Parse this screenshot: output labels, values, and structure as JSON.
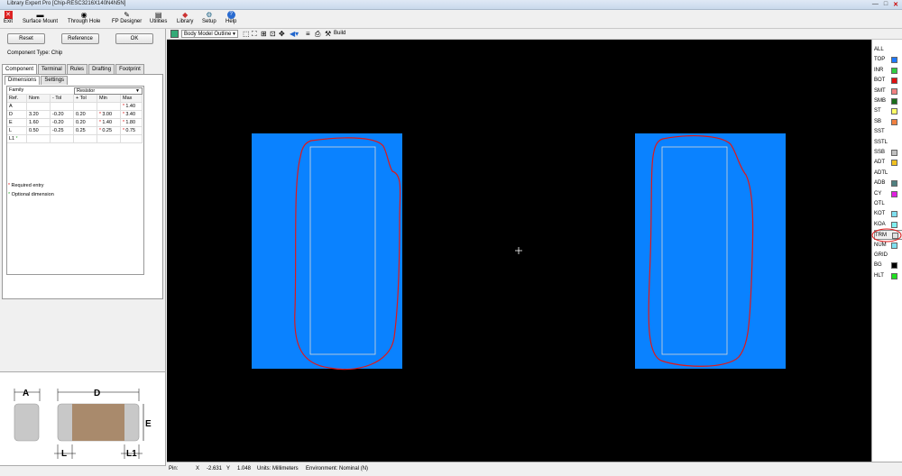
{
  "window": {
    "title": "Library Expert Pro [Chip-RESC3216X140N4N5N]",
    "controls": [
      "—",
      "□",
      "✕"
    ]
  },
  "toolbar": {
    "items": [
      {
        "label": "Exit",
        "icon": "exit-icon"
      },
      {
        "label": "Surface Mount",
        "icon": "surface-mount-icon"
      },
      {
        "label": "Through Hole",
        "icon": "through-hole-icon"
      },
      {
        "label": "FP Designer",
        "icon": "fp-designer-icon"
      },
      {
        "label": "Utilities",
        "icon": "utilities-icon"
      },
      {
        "label": "Library",
        "icon": "library-icon"
      },
      {
        "label": "Setup",
        "icon": "setup-icon"
      },
      {
        "label": "Help",
        "icon": "help-icon"
      }
    ]
  },
  "left": {
    "buttons": {
      "reset": "Reset",
      "reference": "Reference",
      "ok": "OK"
    },
    "component_type": "Component Type: Chip",
    "tabs": [
      "Component",
      "Terminal",
      "Rules",
      "Drafting",
      "Footprint"
    ],
    "subtabs": [
      "Dimensions",
      "Settings"
    ],
    "family_label": "Family",
    "family_value": "Resistor",
    "headers": [
      "Ref.",
      "Nom",
      "- Tol",
      "+ Tol",
      "Min",
      "Max"
    ],
    "rows": [
      {
        "ref": "A",
        "nom": "",
        "mtol": "",
        "ptol": "",
        "min": "",
        "max": "1.40"
      },
      {
        "ref": "D",
        "nom": "3.20",
        "mtol": "-0.20",
        "ptol": "0.20",
        "min": "3.00",
        "max": "3.40"
      },
      {
        "ref": "E",
        "nom": "1.60",
        "mtol": "-0.20",
        "ptol": "0.20",
        "min": "1.40",
        "max": "1.80"
      },
      {
        "ref": "L",
        "nom": "0.50",
        "mtol": "-0.25",
        "ptol": "0.25",
        "min": "0.25",
        "max": "0.75"
      },
      {
        "ref": "L1",
        "nom": "",
        "mtol": "",
        "ptol": "",
        "min": "",
        "max": ""
      }
    ],
    "legend_required": "Required entry",
    "legend_optional": "Optional dimension",
    "diagram_labels": {
      "a": "A",
      "d": "D",
      "e": "E",
      "l": "L",
      "l1": "L1"
    }
  },
  "canvas_toolbar": {
    "view_select": "Body Model Outline",
    "build": "Build"
  },
  "layers": [
    {
      "name": "ALL",
      "color": ""
    },
    {
      "name": "TOP",
      "color": "#1e78ff"
    },
    {
      "name": "INR",
      "color": "#2ecc40"
    },
    {
      "name": "BOT",
      "color": "#e01010"
    },
    {
      "name": "SMT",
      "color": "#f08080"
    },
    {
      "name": "SMB",
      "color": "#1a6e1a"
    },
    {
      "name": "ST",
      "color": "#ffff66"
    },
    {
      "name": "SB",
      "color": "#f08040"
    },
    {
      "name": "SST",
      "color": ""
    },
    {
      "name": "SSTL",
      "color": ""
    },
    {
      "name": "SSB",
      "color": "#c0c0c0"
    },
    {
      "name": "ADT",
      "color": "#f0c020"
    },
    {
      "name": "ADTL",
      "color": ""
    },
    {
      "name": "ADB",
      "color": "#508080"
    },
    {
      "name": "CY",
      "color": "#e020e0"
    },
    {
      "name": "OTL",
      "color": ""
    },
    {
      "name": "KOT",
      "color": "#80e0f0"
    },
    {
      "name": "KOA",
      "color": "#80f0f0"
    },
    {
      "name": "TRM",
      "color": "#e0e0e0"
    },
    {
      "name": "NUM",
      "color": "#80e0f0"
    },
    {
      "name": "GRID",
      "color": ""
    },
    {
      "name": "BG",
      "color": "#000000"
    },
    {
      "name": "HLT",
      "color": "#20e020"
    }
  ],
  "status": {
    "pin": "Pin:",
    "x_label": "X",
    "x_value": "-2.631",
    "y_label": "Y",
    "y_value": "1.048",
    "units": "Units: Millimeters",
    "environment": "Environment: Nominal (N)"
  },
  "colors": {
    "pad": "#0a82ff",
    "body_outline": "#d8d8d8",
    "annotation": "#e01818",
    "body_fill": "#a98a6c"
  }
}
